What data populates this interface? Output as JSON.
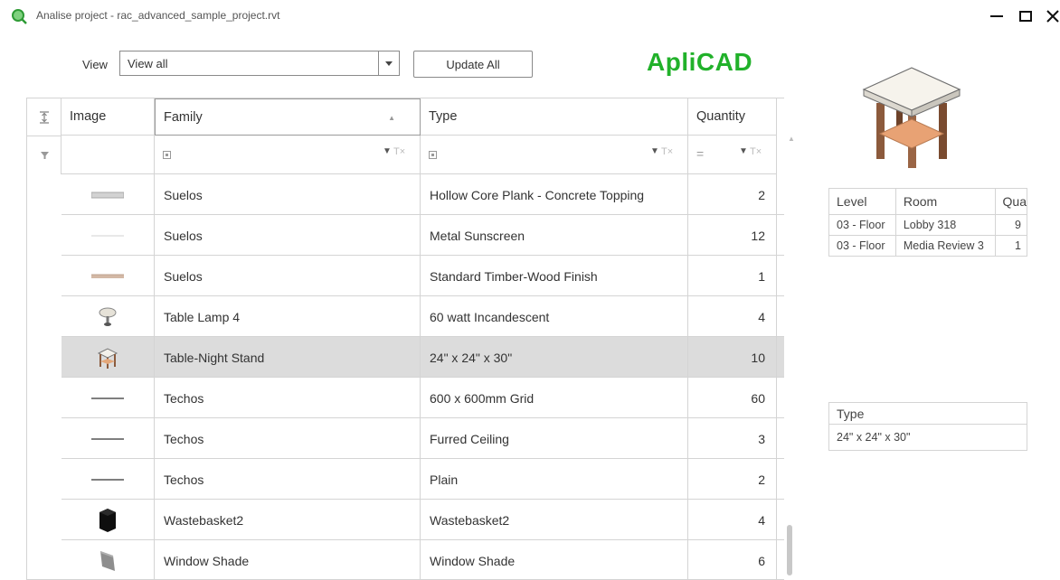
{
  "window": {
    "title": "Analise project - rac_advanced_sample_project.rvt",
    "icons": {
      "app": "search-magnifier-icon",
      "minimize": "minimize-icon",
      "maximize": "maximize-icon",
      "close": "close-icon"
    }
  },
  "toolbar": {
    "view_label": "View",
    "view_value": "View all",
    "update_label": "Update All",
    "brand": "ApliCAD"
  },
  "colors": {
    "brand": "#21b12a",
    "selected_row": "#dcdcdc"
  },
  "grid": {
    "columns": [
      "Image",
      "Family",
      "Type",
      "Quantity"
    ],
    "rows": [
      {
        "family": "Suelos",
        "type": "Hollow Core Plank - Concrete Topping",
        "quantity": "2",
        "thumb": "floor-slab-thumbnail"
      },
      {
        "family": "Suelos",
        "type": "Metal Sunscreen",
        "quantity": "12",
        "thumb": "thin-line-thumbnail"
      },
      {
        "family": "Suelos",
        "type": "Standard Timber-Wood Finish",
        "quantity": "1",
        "thumb": "wood-floor-thumbnail"
      },
      {
        "family": "Table Lamp 4",
        "type": "60 watt Incandescent",
        "quantity": "4",
        "thumb": "table-lamp-thumbnail"
      },
      {
        "family": "Table-Night Stand",
        "type": "24\" x 24\" x 30\"",
        "quantity": "10",
        "thumb": "night-stand-thumbnail",
        "selected": true
      },
      {
        "family": "Techos",
        "type": "600 x 600mm Grid",
        "quantity": "60",
        "thumb": "ceiling-line-thumbnail"
      },
      {
        "family": "Techos",
        "type": "Furred Ceiling",
        "quantity": "3",
        "thumb": "ceiling-line-thumbnail"
      },
      {
        "family": "Techos",
        "type": "Plain",
        "quantity": "2",
        "thumb": "ceiling-line-thumbnail"
      },
      {
        "family": "Wastebasket2",
        "type": "Wastebasket2",
        "quantity": "4",
        "thumb": "wastebasket-thumbnail"
      },
      {
        "family": "Window Shade",
        "type": "Window Shade",
        "quantity": "6",
        "thumb": "window-shade-thumbnail"
      }
    ]
  },
  "rooms_table": {
    "headers": [
      "Level",
      "Room",
      "Qua"
    ],
    "rows": [
      [
        "03 - Floor",
        "Lobby 318",
        "9"
      ],
      [
        "03 - Floor",
        "Media Review 3",
        "1"
      ]
    ]
  },
  "type_table": {
    "header": "Type",
    "value": "24\" x 24\" x 30\""
  }
}
